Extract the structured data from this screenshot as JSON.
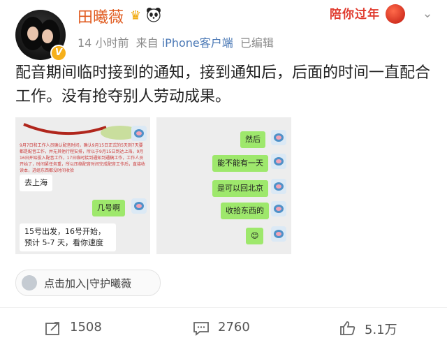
{
  "post": {
    "username": "田曦薇",
    "time": "14 小时前",
    "source_prefix": "来自",
    "source": "iPhone客户端",
    "edited": "已编辑",
    "text": "配音期间临时接到的通知，接到通知后，后面的时间一直配合工作。没有抢夺别人劳动成果。",
    "festival_badge": "陪你过年",
    "badges": [
      "crown-icon",
      "panda-icon",
      "verified-v-icon"
    ]
  },
  "images": {
    "left": {
      "notice_text": "9月7日和工作人员确认配音时间，确认9月15日正式的5天到7天要都是配音工作，并无其他行程安排，所以于9月15日到达上海，9月16日开始投入配音工作，17日临时接到通知到通稿工作，工作人员开始了，时间紧任务重，所以压缩配音时间完成配音工作后，直接收读本，进组东西都没时间收拾",
      "msg1": "去上海",
      "msg2": "几号啊",
      "msg3": "15号出发，16号开始，预计 5-7 天，看你速度"
    },
    "right": {
      "msg1": "然后",
      "msg2": "能不能有一天",
      "msg3": "是可以回北京",
      "msg4": "收拾东西的",
      "msg5": "😊"
    }
  },
  "topic_tag": "点击加入|守护曦薇",
  "actions": {
    "repost": "1508",
    "comment": "2760",
    "like": "5.1万"
  },
  "colors": {
    "username": "#e05a1e",
    "source_link": "#4a78b5",
    "chat_green": "#9ee86c",
    "festival_red": "#e03a2e"
  }
}
